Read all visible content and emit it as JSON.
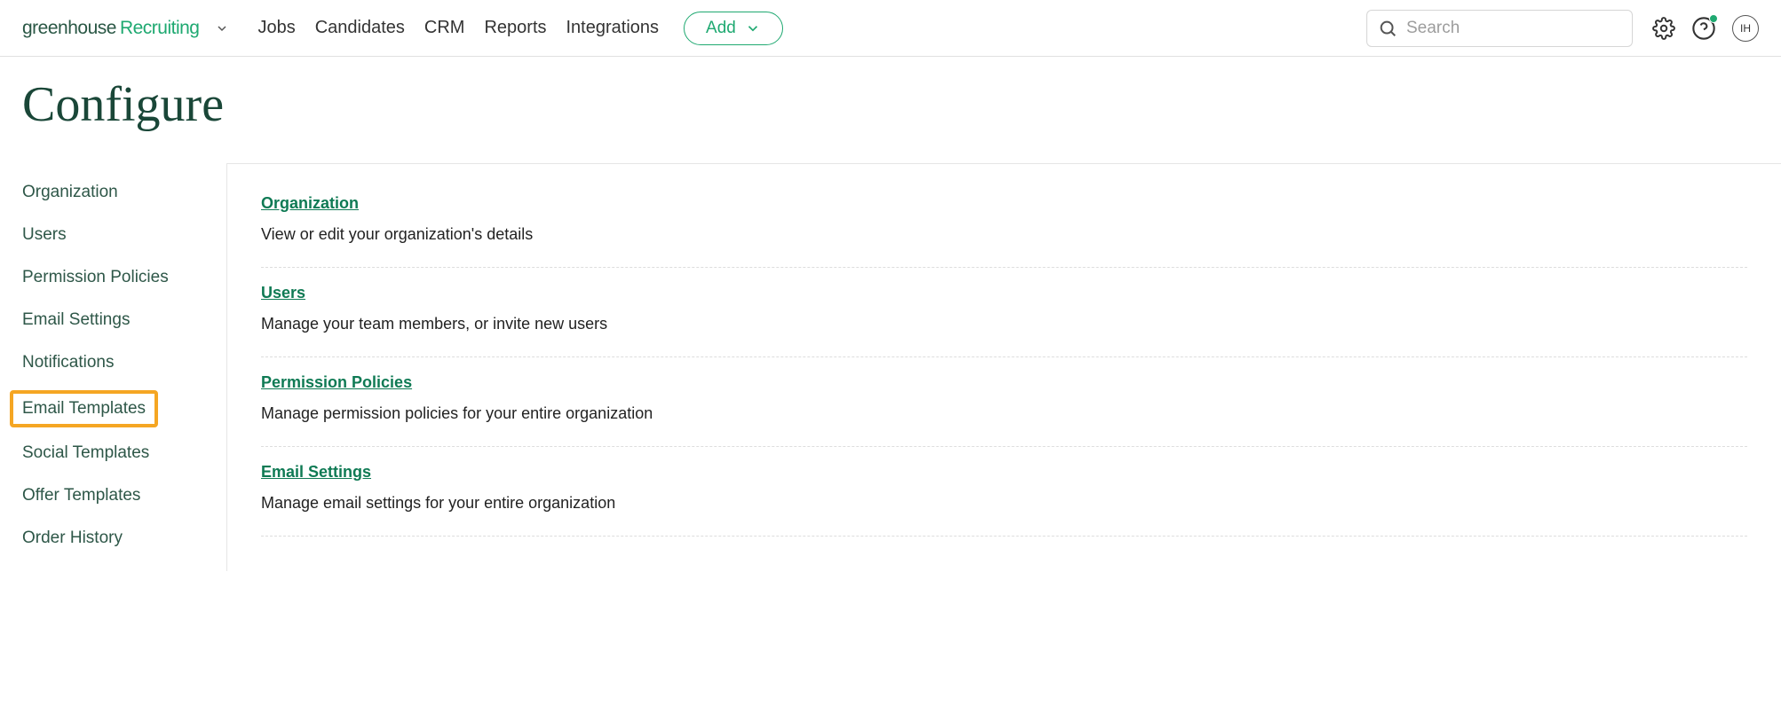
{
  "header": {
    "logo_part1": "greenhouse",
    "logo_part2": "Recruiting",
    "nav": [
      "Jobs",
      "Candidates",
      "CRM",
      "Reports",
      "Integrations"
    ],
    "add_label": "Add",
    "search_placeholder": "Search",
    "avatar_initials": "IH"
  },
  "page_title": "Configure",
  "sidebar": {
    "items": [
      {
        "label": "Organization",
        "highlight": false
      },
      {
        "label": "Users",
        "highlight": false
      },
      {
        "label": "Permission Policies",
        "highlight": false
      },
      {
        "label": "Email Settings",
        "highlight": false
      },
      {
        "label": "Notifications",
        "highlight": false
      },
      {
        "label": "Email Templates",
        "highlight": true
      },
      {
        "label": "Social Templates",
        "highlight": false
      },
      {
        "label": "Offer Templates",
        "highlight": false
      },
      {
        "label": "Order History",
        "highlight": false
      }
    ]
  },
  "sections": [
    {
      "title": "Organization",
      "desc": "View or edit your organization's details"
    },
    {
      "title": "Users",
      "desc": "Manage your team members, or invite new users"
    },
    {
      "title": "Permission Policies",
      "desc": "Manage permission policies for your entire organization"
    },
    {
      "title": "Email Settings",
      "desc": "Manage email settings for your entire organization"
    }
  ]
}
